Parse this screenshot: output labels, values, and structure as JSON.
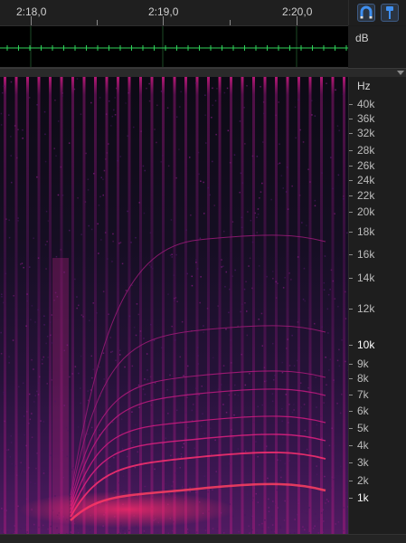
{
  "timeline": {
    "labels": [
      "2:18,0",
      "2:19,0",
      "2:20,0"
    ]
  },
  "tools": [
    {
      "name": "marquee-tool",
      "icon": "horseshoe-magnet-icon"
    },
    {
      "name": "pin-tool",
      "icon": "pushpin-icon"
    }
  ],
  "amplitude_ruler": {
    "unit": "dB"
  },
  "frequency_ruler": {
    "unit": "Hz",
    "labels": [
      "40k",
      "36k",
      "32k",
      "28k",
      "26k",
      "24k",
      "22k",
      "20k",
      "18k",
      "16k",
      "14k",
      "12k",
      "10k",
      "9k",
      "8k",
      "7k",
      "6k",
      "5k",
      "4k",
      "3k",
      "2k",
      "1k"
    ]
  },
  "colors": {
    "accent": "#d0208a",
    "waveform": "#2fd35a",
    "tool_highlight": "#3d5b86"
  }
}
